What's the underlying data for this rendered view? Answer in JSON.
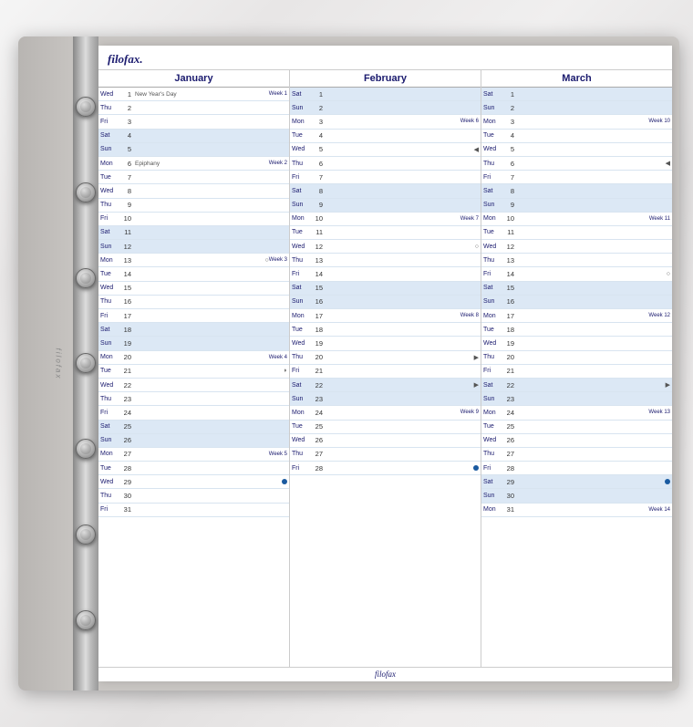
{
  "binder": {
    "logo": "filofax.",
    "footer_logo": "filofax"
  },
  "months": [
    {
      "name": "January",
      "days": [
        {
          "name": "Wed",
          "num": "1",
          "note": "New Year's Day",
          "week": "Week 1",
          "type": "weekday"
        },
        {
          "name": "Thu",
          "num": "2",
          "note": "",
          "week": "",
          "type": "weekday"
        },
        {
          "name": "Fri",
          "num": "3",
          "note": "",
          "week": "",
          "type": "weekday"
        },
        {
          "name": "Sat",
          "num": "4",
          "note": "",
          "week": "",
          "type": "weekend"
        },
        {
          "name": "Sun",
          "num": "5",
          "note": "",
          "week": "",
          "type": "weekend"
        },
        {
          "name": "Mon",
          "num": "6",
          "note": "Epiphany",
          "week": "Week 2",
          "type": "weekday"
        },
        {
          "name": "Tue",
          "num": "7",
          "note": "",
          "week": "",
          "type": "weekday"
        },
        {
          "name": "Wed",
          "num": "8",
          "note": "",
          "week": "",
          "type": "weekday"
        },
        {
          "name": "Thu",
          "num": "9",
          "note": "",
          "week": "",
          "type": "weekday"
        },
        {
          "name": "Fri",
          "num": "10",
          "note": "",
          "week": "",
          "type": "weekday"
        },
        {
          "name": "Sat",
          "num": "11",
          "note": "",
          "week": "",
          "type": "weekend"
        },
        {
          "name": "Sun",
          "num": "12",
          "note": "",
          "week": "",
          "type": "weekend"
        },
        {
          "name": "Mon",
          "num": "13",
          "note": "",
          "week": "Week 3",
          "type": "weekday",
          "moon": "○"
        },
        {
          "name": "Tue",
          "num": "14",
          "note": "",
          "week": "",
          "type": "weekday"
        },
        {
          "name": "Wed",
          "num": "15",
          "note": "",
          "week": "",
          "type": "weekday"
        },
        {
          "name": "Thu",
          "num": "16",
          "note": "",
          "week": "",
          "type": "weekday"
        },
        {
          "name": "Fri",
          "num": "17",
          "note": "",
          "week": "",
          "type": "weekday"
        },
        {
          "name": "Sat",
          "num": "18",
          "note": "",
          "week": "",
          "type": "weekend"
        },
        {
          "name": "Sun",
          "num": "19",
          "note": "",
          "week": "",
          "type": "weekend"
        },
        {
          "name": "Mon",
          "num": "20",
          "note": "",
          "week": "Week 4",
          "type": "weekday"
        },
        {
          "name": "Tue",
          "num": "21",
          "note": "",
          "week": "",
          "type": "weekday",
          "moon": "◗"
        },
        {
          "name": "Wed",
          "num": "22",
          "note": "",
          "week": "",
          "type": "weekday"
        },
        {
          "name": "Thu",
          "num": "23",
          "note": "",
          "week": "",
          "type": "weekday"
        },
        {
          "name": "Fri",
          "num": "24",
          "note": "",
          "week": "",
          "type": "weekday"
        },
        {
          "name": "Sat",
          "num": "25",
          "note": "",
          "week": "",
          "type": "weekend"
        },
        {
          "name": "Sun",
          "num": "26",
          "note": "",
          "week": "",
          "type": "weekend"
        },
        {
          "name": "Mon",
          "num": "27",
          "note": "",
          "week": "Week 5",
          "type": "weekday"
        },
        {
          "name": "Tue",
          "num": "28",
          "note": "",
          "week": "",
          "type": "weekday"
        },
        {
          "name": "Wed",
          "num": "29",
          "note": "",
          "week": "",
          "type": "weekday",
          "dot": true
        },
        {
          "name": "Thu",
          "num": "30",
          "note": "",
          "week": "",
          "type": "weekday"
        },
        {
          "name": "Fri",
          "num": "31",
          "note": "",
          "week": "",
          "type": "weekday"
        }
      ]
    },
    {
      "name": "February",
      "days": [
        {
          "name": "Sat",
          "num": "1",
          "note": "",
          "week": "",
          "type": "weekend"
        },
        {
          "name": "Sun",
          "num": "2",
          "note": "",
          "week": "",
          "type": "weekend"
        },
        {
          "name": "Mon",
          "num": "3",
          "note": "",
          "week": "Week 6",
          "type": "weekday"
        },
        {
          "name": "Tue",
          "num": "4",
          "note": "",
          "week": "",
          "type": "weekday"
        },
        {
          "name": "Wed",
          "num": "5",
          "note": "",
          "week": "",
          "type": "weekday",
          "moon": "◀"
        },
        {
          "name": "Thu",
          "num": "6",
          "note": "",
          "week": "",
          "type": "weekday"
        },
        {
          "name": "Fri",
          "num": "7",
          "note": "",
          "week": "",
          "type": "weekday"
        },
        {
          "name": "Sat",
          "num": "8",
          "note": "",
          "week": "",
          "type": "weekend"
        },
        {
          "name": "Sun",
          "num": "9",
          "note": "",
          "week": "",
          "type": "weekend"
        },
        {
          "name": "Mon",
          "num": "10",
          "note": "",
          "week": "Week 7",
          "type": "weekday"
        },
        {
          "name": "Tue",
          "num": "11",
          "note": "",
          "week": "",
          "type": "weekday"
        },
        {
          "name": "Wed",
          "num": "12",
          "note": "",
          "week": "",
          "type": "weekday",
          "moon": "○"
        },
        {
          "name": "Thu",
          "num": "13",
          "note": "",
          "week": "",
          "type": "weekday"
        },
        {
          "name": "Fri",
          "num": "14",
          "note": "",
          "week": "",
          "type": "weekday"
        },
        {
          "name": "Sat",
          "num": "15",
          "note": "",
          "week": "",
          "type": "weekend"
        },
        {
          "name": "Sun",
          "num": "16",
          "note": "",
          "week": "",
          "type": "weekend"
        },
        {
          "name": "Mon",
          "num": "17",
          "note": "",
          "week": "Week 8",
          "type": "weekday"
        },
        {
          "name": "Tue",
          "num": "18",
          "note": "",
          "week": "",
          "type": "weekday"
        },
        {
          "name": "Wed",
          "num": "19",
          "note": "",
          "week": "",
          "type": "weekday"
        },
        {
          "name": "Thu",
          "num": "20",
          "note": "",
          "week": "",
          "type": "weekday",
          "moon": "▶"
        },
        {
          "name": "Fri",
          "num": "21",
          "note": "",
          "week": "",
          "type": "weekday"
        },
        {
          "name": "Sat",
          "num": "22",
          "note": "",
          "week": "",
          "type": "weekend",
          "moon": "▶"
        },
        {
          "name": "Sun",
          "num": "23",
          "note": "",
          "week": "",
          "type": "weekend"
        },
        {
          "name": "Mon",
          "num": "24",
          "note": "",
          "week": "Week 9",
          "type": "weekday"
        },
        {
          "name": "Tue",
          "num": "25",
          "note": "",
          "week": "",
          "type": "weekday"
        },
        {
          "name": "Wed",
          "num": "26",
          "note": "",
          "week": "",
          "type": "weekday"
        },
        {
          "name": "Thu",
          "num": "27",
          "note": "",
          "week": "",
          "type": "weekday"
        },
        {
          "name": "Fri",
          "num": "28",
          "note": "",
          "week": "",
          "type": "weekday",
          "dot": true
        }
      ]
    },
    {
      "name": "March",
      "days": [
        {
          "name": "Sat",
          "num": "1",
          "note": "",
          "week": "",
          "type": "weekend"
        },
        {
          "name": "Sun",
          "num": "2",
          "note": "",
          "week": "",
          "type": "weekend"
        },
        {
          "name": "Mon",
          "num": "3",
          "note": "",
          "week": "Week 10",
          "type": "weekday"
        },
        {
          "name": "Tue",
          "num": "4",
          "note": "",
          "week": "",
          "type": "weekday"
        },
        {
          "name": "Wed",
          "num": "5",
          "note": "",
          "week": "",
          "type": "weekday"
        },
        {
          "name": "Thu",
          "num": "6",
          "note": "",
          "week": "",
          "type": "weekday",
          "moon": "◀"
        },
        {
          "name": "Fri",
          "num": "7",
          "note": "",
          "week": "",
          "type": "weekday"
        },
        {
          "name": "Sat",
          "num": "8",
          "note": "",
          "week": "",
          "type": "weekend"
        },
        {
          "name": "Sun",
          "num": "9",
          "note": "",
          "week": "",
          "type": "weekend"
        },
        {
          "name": "Mon",
          "num": "10",
          "note": "",
          "week": "Week 11",
          "type": "weekday"
        },
        {
          "name": "Tue",
          "num": "11",
          "note": "",
          "week": "",
          "type": "weekday"
        },
        {
          "name": "Wed",
          "num": "12",
          "note": "",
          "week": "",
          "type": "weekday"
        },
        {
          "name": "Thu",
          "num": "13",
          "note": "",
          "week": "",
          "type": "weekday"
        },
        {
          "name": "Fri",
          "num": "14",
          "note": "",
          "week": "",
          "type": "weekday",
          "moon": "○"
        },
        {
          "name": "Sat",
          "num": "15",
          "note": "",
          "week": "",
          "type": "weekend"
        },
        {
          "name": "Sun",
          "num": "16",
          "note": "",
          "week": "",
          "type": "weekend"
        },
        {
          "name": "Mon",
          "num": "17",
          "note": "",
          "week": "Week 12",
          "type": "weekday"
        },
        {
          "name": "Tue",
          "num": "18",
          "note": "",
          "week": "",
          "type": "weekday"
        },
        {
          "name": "Wed",
          "num": "19",
          "note": "",
          "week": "",
          "type": "weekday"
        },
        {
          "name": "Thu",
          "num": "20",
          "note": "",
          "week": "",
          "type": "weekday"
        },
        {
          "name": "Fri",
          "num": "21",
          "note": "",
          "week": "",
          "type": "weekday"
        },
        {
          "name": "Sat",
          "num": "22",
          "note": "",
          "week": "",
          "type": "weekend",
          "moon": "▶"
        },
        {
          "name": "Sun",
          "num": "23",
          "note": "",
          "week": "",
          "type": "weekend"
        },
        {
          "name": "Mon",
          "num": "24",
          "note": "",
          "week": "Week 13",
          "type": "weekday"
        },
        {
          "name": "Tue",
          "num": "25",
          "note": "",
          "week": "",
          "type": "weekday"
        },
        {
          "name": "Wed",
          "num": "26",
          "note": "",
          "week": "",
          "type": "weekday"
        },
        {
          "name": "Thu",
          "num": "27",
          "note": "",
          "week": "",
          "type": "weekday"
        },
        {
          "name": "Fri",
          "num": "28",
          "note": "",
          "week": "",
          "type": "weekday"
        },
        {
          "name": "Sat",
          "num": "29",
          "note": "",
          "week": "",
          "type": "weekend",
          "dot": true
        },
        {
          "name": "Sun",
          "num": "30",
          "note": "",
          "week": "",
          "type": "weekend"
        },
        {
          "name": "Mon",
          "num": "31",
          "note": "",
          "week": "Week 14",
          "type": "weekday"
        }
      ]
    }
  ]
}
